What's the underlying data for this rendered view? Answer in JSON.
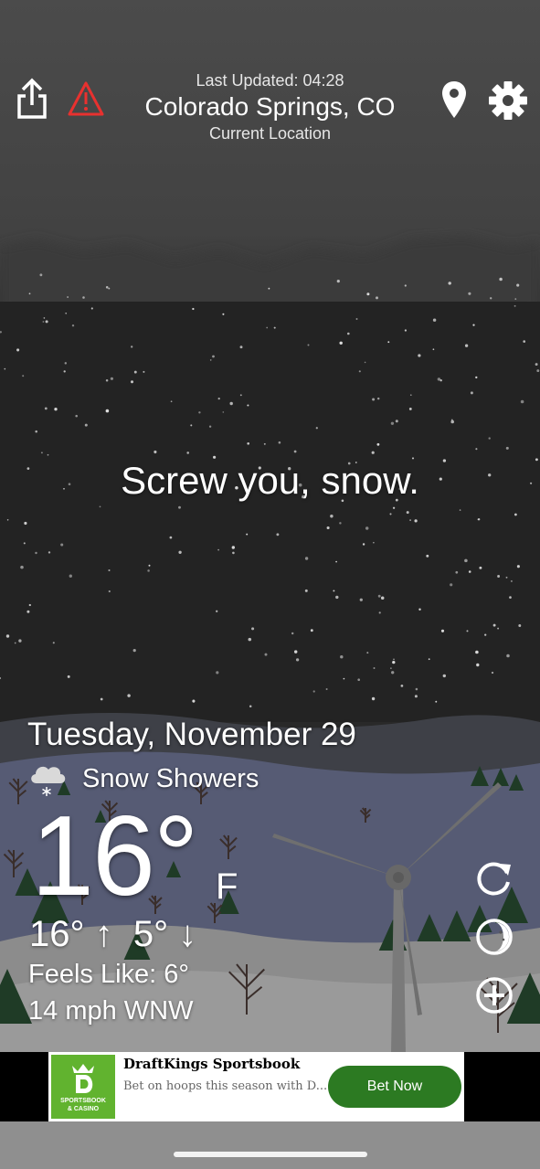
{
  "header": {
    "last_updated": "Last Updated: 04:28",
    "location": "Colorado Springs, CO",
    "location_sub": "Current Location"
  },
  "main": {
    "message": "Screw you, snow."
  },
  "weather": {
    "date": "Tuesday, November 29",
    "condition": "Snow Showers",
    "temperature": "16°",
    "unit": "F",
    "high_low": "16° ↑  5° ↓",
    "feels_like": "Feels Like: 6°",
    "wind": "14 mph WNW"
  },
  "ad": {
    "title": "DraftKings Sportsbook",
    "body": "Bet on hoops this season with D...",
    "cta": "Bet Now",
    "logo_text_1": "SPORTSBOOK",
    "logo_text_2": "& CASINO",
    "colors": {
      "brand_green": "#61b32f",
      "cta_green": "#2c7a22"
    }
  },
  "icons": {
    "share": "share-icon",
    "alert": "alert-triangle-icon",
    "location": "location-pin-icon",
    "settings": "gear-icon",
    "refresh": "refresh-icon",
    "moon": "moon-phase-icon",
    "add": "add-circle-icon",
    "condition": "snow-cloud-icon"
  },
  "colors": {
    "alert_red": "#e8312f",
    "sky_top": "#4a4a4a",
    "sky_dark": "#222222"
  }
}
